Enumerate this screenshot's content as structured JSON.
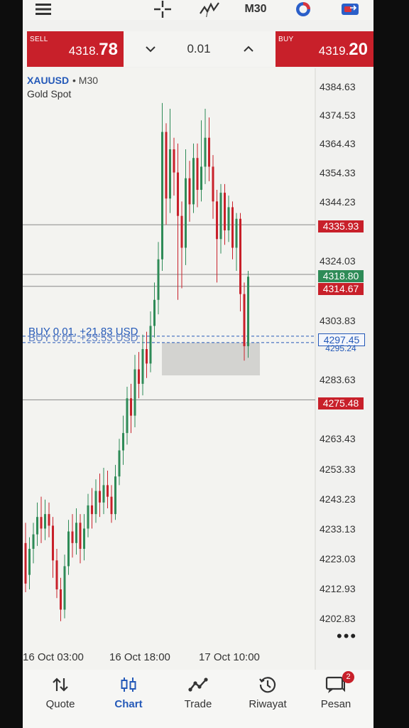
{
  "toolbar": {
    "menu_icon": "hamburger-icon",
    "crosshair_icon": "crosshair-icon",
    "indicators_icon": "indicator-f-icon",
    "timeframe": "M30",
    "objects_icon": "color-wheel-icon",
    "account_icon": "exchange-icon"
  },
  "trade_bar": {
    "sell_label": "SELL",
    "sell_price_small": "4318.",
    "sell_price_big": "78",
    "buy_label": "BUY",
    "buy_price_small": "4319.",
    "buy_price_big": "20",
    "lot_value": "0.01",
    "lot_down_icon": "chevron-down-icon",
    "lot_up_icon": "chevron-up-icon"
  },
  "chart": {
    "symbol": "XAUUSD",
    "timeframe_label": "• M30",
    "description": "Gold Spot",
    "price_levels": [
      "4384.63",
      "4374.53",
      "4364.43",
      "4354.33",
      "4344.23",
      "4324.03",
      "4303.83",
      "4283.63",
      "4263.43",
      "4253.33",
      "4243.23",
      "4233.13",
      "4223.03",
      "4212.93",
      "4202.83"
    ],
    "tags": {
      "red_1": "4335.93",
      "green": "4318.80",
      "red_2": "4314.67",
      "outline_1": "4297.45",
      "outline_2": "4295.24",
      "red_3": "4275.48"
    },
    "buy_line_1": "BUY 0.01,  +21.83 USD",
    "buy_line_2": "BUY 0.01,  +23.53 USD",
    "time_labels": [
      "16 Oct 03:00",
      "16 Oct 18:00",
      "17 Oct 10:00"
    ],
    "more_icon": "more-dots-icon"
  },
  "chart_data": {
    "type": "candlestick",
    "title": "",
    "ylim": [
      4196,
      4390
    ],
    "price_lines": [
      4335.93,
      4318.8,
      4314.67,
      4297.45,
      4295.24,
      4275.48
    ],
    "colors": {
      "bull": "#2e8b57",
      "bear": "#c8202a",
      "line": "#888888",
      "buy_line": "#2459b8"
    },
    "candles": [
      [
        4226,
        4212,
        4233,
        4209
      ],
      [
        4215,
        4224,
        4228,
        4210
      ],
      [
        4224,
        4229,
        4233,
        4219
      ],
      [
        4229,
        4235,
        4240,
        4225
      ],
      [
        4235,
        4231,
        4242,
        4226
      ],
      [
        4231,
        4236,
        4241,
        4227
      ],
      [
        4236,
        4232,
        4240,
        4228
      ],
      [
        4232,
        4220,
        4235,
        4214
      ],
      [
        4220,
        4210,
        4224,
        4207
      ],
      [
        4210,
        4203,
        4214,
        4199
      ],
      [
        4203,
        4218,
        4222,
        4200
      ],
      [
        4218,
        4230,
        4234,
        4215
      ],
      [
        4230,
        4226,
        4236,
        4221
      ],
      [
        4226,
        4233,
        4238,
        4222
      ],
      [
        4233,
        4224,
        4236,
        4219
      ],
      [
        4224,
        4231,
        4236,
        4220
      ],
      [
        4231,
        4239,
        4243,
        4228
      ],
      [
        4239,
        4236,
        4245,
        4231
      ],
      [
        4236,
        4244,
        4248,
        4233
      ],
      [
        4244,
        4240,
        4250,
        4235
      ],
      [
        4240,
        4246,
        4252,
        4236
      ],
      [
        4246,
        4242,
        4251,
        4238
      ],
      [
        4242,
        4236,
        4246,
        4233
      ],
      [
        4236,
        4249,
        4253,
        4234
      ],
      [
        4249,
        4258,
        4262,
        4246
      ],
      [
        4258,
        4264,
        4270,
        4253
      ],
      [
        4264,
        4276,
        4280,
        4260
      ],
      [
        4276,
        4270,
        4281,
        4264
      ],
      [
        4270,
        4286,
        4291,
        4266
      ],
      [
        4286,
        4281,
        4292,
        4276
      ],
      [
        4281,
        4293,
        4298,
        4277
      ],
      [
        4293,
        4288,
        4299,
        4283
      ],
      [
        4288,
        4301,
        4306,
        4285
      ],
      [
        4301,
        4310,
        4316,
        4297
      ],
      [
        4310,
        4324,
        4330,
        4305
      ],
      [
        4324,
        4368,
        4378,
        4320
      ],
      [
        4368,
        4345,
        4371,
        4336
      ],
      [
        4345,
        4362,
        4376,
        4340
      ],
      [
        4362,
        4354,
        4366,
        4346
      ],
      [
        4354,
        4339,
        4364,
        4310
      ],
      [
        4339,
        4328,
        4344,
        4314
      ],
      [
        4328,
        4352,
        4362,
        4322
      ],
      [
        4352,
        4343,
        4358,
        4337
      ],
      [
        4343,
        4359,
        4364,
        4340
      ],
      [
        4359,
        4348,
        4364,
        4342
      ],
      [
        4348,
        4356,
        4372,
        4344
      ],
      [
        4356,
        4366,
        4376,
        4350
      ],
      [
        4366,
        4356,
        4373,
        4351
      ],
      [
        4356,
        4344,
        4360,
        4338
      ],
      [
        4344,
        4331,
        4348,
        4316
      ],
      [
        4331,
        4347,
        4350,
        4326
      ],
      [
        4347,
        4334,
        4350,
        4329
      ],
      [
        4334,
        4342,
        4346,
        4330
      ],
      [
        4342,
        4328,
        4344,
        4324
      ],
      [
        4328,
        4338,
        4340,
        4320
      ],
      [
        4338,
        4312,
        4340,
        4306
      ],
      [
        4312,
        4294,
        4316,
        4289
      ],
      [
        4294,
        4318,
        4320,
        4290
      ]
    ]
  },
  "bottom_nav": {
    "quote": "Quote",
    "chart": "Chart",
    "trade": "Trade",
    "history": "Riwayat",
    "messages": "Pesan",
    "messages_badge": "2"
  }
}
